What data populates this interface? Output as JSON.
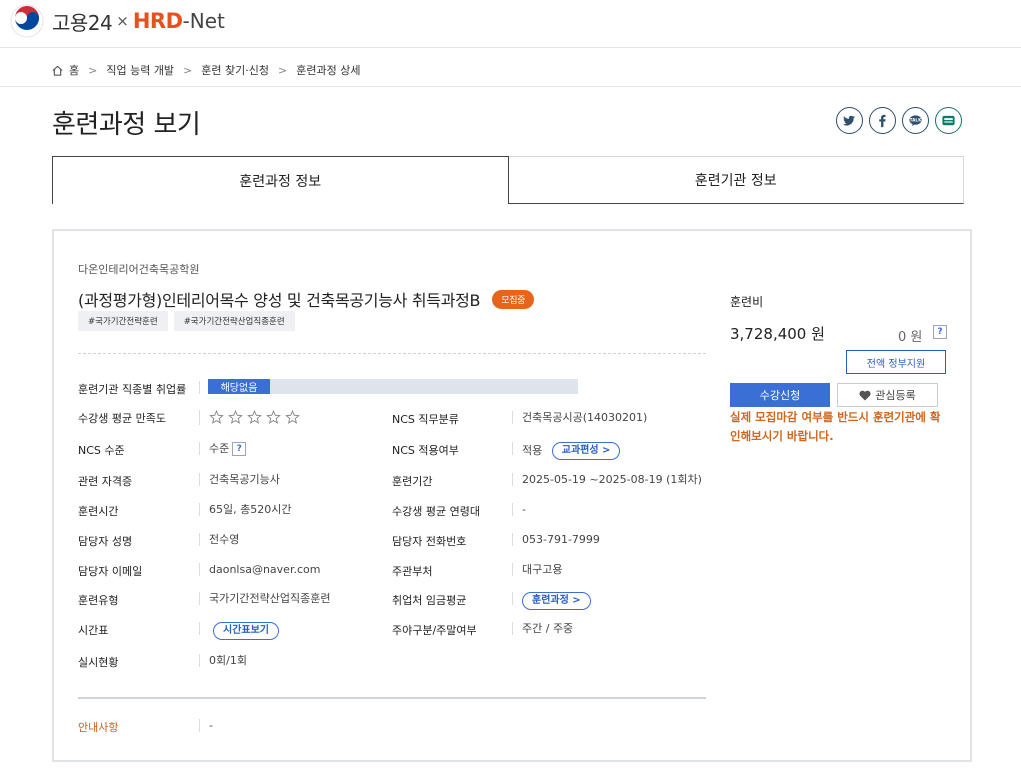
{
  "header": {
    "logo_text": "고용24",
    "logo_x": "×",
    "logo_hrd": "HRD",
    "logo_net": "-Net"
  },
  "breadcrumb": {
    "items": [
      "홈",
      "직업 능력 개발",
      "훈련 찾기·신청",
      "훈련과정 상세"
    ],
    "separator": ">"
  },
  "page": {
    "title": "훈련과정 보기"
  },
  "share": [
    "twitter-icon",
    "facebook-icon",
    "kakaotalk-icon",
    "kakaostory-icon"
  ],
  "tabs": [
    {
      "label": "훈련과정 정보",
      "active": true
    },
    {
      "label": "훈련기관 정보",
      "active": false
    }
  ],
  "course": {
    "institution": "다온인테리어건축목공학원",
    "title": "(과정평가형)인테리어목수 양성 및 건축목공기능사 취득과정B",
    "status_badge": "모집중",
    "tags": [
      "#국가기간전략훈련",
      "#국가기간전략산업직종훈련"
    ]
  },
  "details": {
    "employment_rate_label": "훈련기관 직종별 취업률",
    "employment_rate_value": "해당없음",
    "satisfaction_label": "수강생 평균 만족도",
    "satisfaction_stars": 0,
    "satisfaction_max": 5,
    "ncs_job_label": "NCS 직무분류",
    "ncs_job_value": "건축목공시공(14030201)",
    "ncs_level_label": "NCS 수준",
    "ncs_level_value": "수준",
    "ncs_apply_label": "NCS 적용여부",
    "ncs_apply_value": "적용",
    "curriculum_button": "교과편성 >",
    "cert_label": "관련 자격증",
    "cert_value": "건축목공기능사",
    "period_label": "훈련기간",
    "period_value": "2025-05-19 ~2025-08-19 (1회차)",
    "hours_label": "훈련시간",
    "hours_value": "65일, 총520시간",
    "age_label": "수강생 평균 연령대",
    "age_value": "-",
    "manager_label": "담당자 성명",
    "manager_value": "전수영",
    "phone_label": "담당자 전화번호",
    "phone_value": "053-791-7999",
    "email_label": "담당자 이메일",
    "email_value": "daonlsa@naver.com",
    "agency_label": "주관부처",
    "agency_value": "대구고용",
    "type_label": "훈련유형",
    "type_value": "국가기간전략산업직종훈련",
    "wage_label": "취업처 임금평균",
    "wage_button": "훈련과정 >",
    "timetable_label": "시간표",
    "timetable_button": "시간표보기",
    "daynight_label": "주야구분/주말여부",
    "daynight_value": "주간 / 주중",
    "status_label": "실시현황",
    "status_value": "0회/1회",
    "notice_label": "안내사항",
    "notice_value": "-"
  },
  "side": {
    "fee_label": "훈련비",
    "fee_value": "3,728,400 원",
    "fee_self": "0 원",
    "fee_help": "?",
    "support_button": "전액 정부지원",
    "apply_button": "수강신청",
    "fav_button": "관심등록",
    "warning": "실제 모집마감 여부를 반드시 훈련기관에 확인해보시기 바랍니다."
  },
  "colors": {
    "accent": "#3a6fd6",
    "brand_orange": "#e8501e",
    "warning": "#d2661c"
  }
}
